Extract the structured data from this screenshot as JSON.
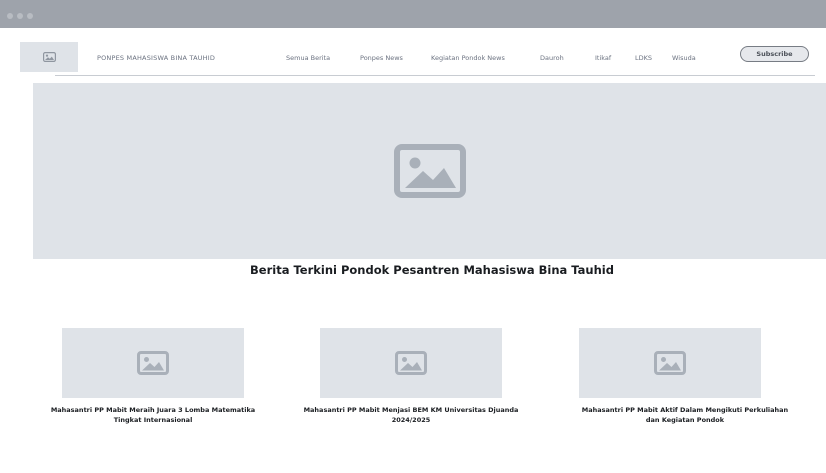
{
  "navbar": {
    "brand": "PONPES MAHASISWA BINA TAUHID",
    "links": [
      "Semua Berita",
      "Ponpes News",
      "Kegiatan Pondok News",
      "Dauroh",
      "Itikaf",
      "LDKS",
      "Wisuda"
    ],
    "subscribe_label": "Subscribe"
  },
  "hero": {
    "headline": "Berita Terkini Pondok Pesantren Mahasiswa Bina Tauhid"
  },
  "articles": [
    {
      "title": "Mahasantri PP Mabit Meraih Juara 3 Lomba Matematika Tingkat Internasional"
    },
    {
      "title": "Mahasantri PP Mabit Menjasi BEM KM Universitas Djuanda 2024/2025"
    },
    {
      "title": "Mahasantri PP Mabit Aktif Dalam Mengikuti Perkuliahan dan Kegiatan Pondok"
    }
  ],
  "icons": {
    "placeholder": "image-placeholder-icon",
    "window_controls": "window-dot-icon"
  },
  "colors": {
    "titlebar": "#9ea3ab",
    "placeholder": "#dfe3e8",
    "icon": "#a9b0b9",
    "text_dark": "#1a1d21",
    "text_muted": "#6b7280"
  }
}
